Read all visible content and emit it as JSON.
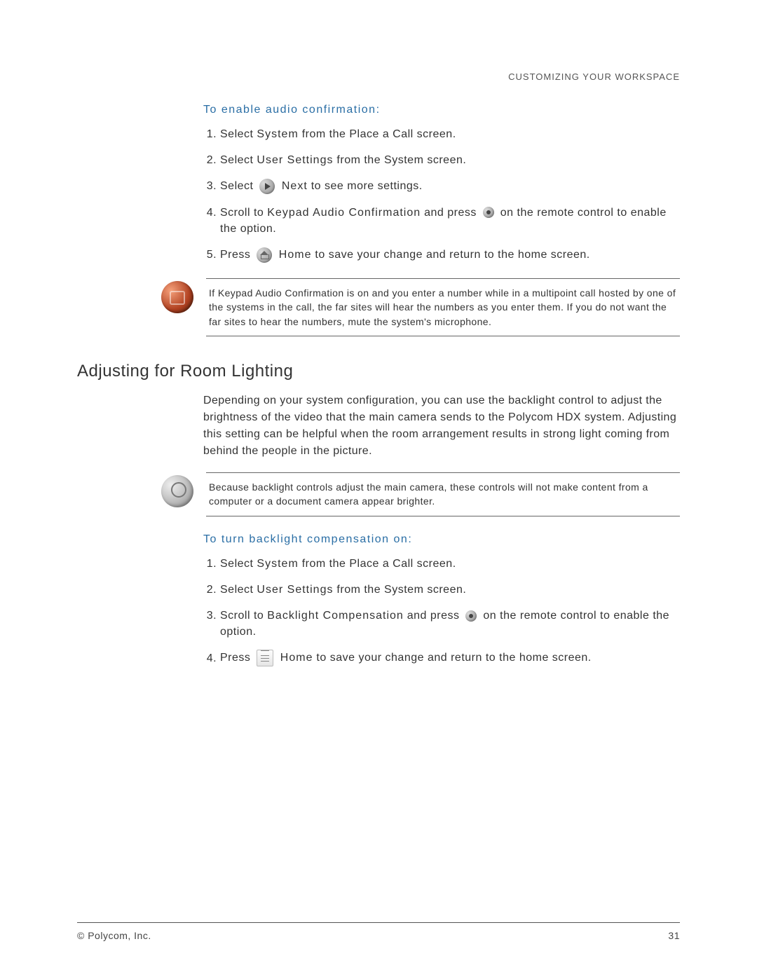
{
  "header": {
    "right": "CUSTOMIZING YOUR WORKSPACE"
  },
  "section1": {
    "proc_title": "To enable audio confirmation:",
    "s1_a": "Select ",
    "s1_b": "System",
    "s1_c": " from the Place a Call screen.",
    "s2_a": "Select ",
    "s2_b": "User Settings",
    "s2_c": " from the System screen.",
    "s3_a": "Select ",
    "s3_b": " Next",
    "s3_c": " to see more settings.",
    "s4_a": "Scroll to ",
    "s4_b": "Keypad Audio Confirmation",
    "s4_c": " and press ",
    "s4_d": " on the remote control to enable the option.",
    "s5_a": "Press ",
    "s5_b": " Home",
    "s5_c": " to save your change and return to the home screen.",
    "note": "If Keypad Audio Confirmation is on and you enter a number while in a multipoint call hosted by one of the systems in the call, the far sites will hear the numbers as you enter them. If you do not want the far sites to hear the numbers, mute the system's microphone."
  },
  "section2": {
    "heading": "Adjusting for Room Lighting",
    "para": "Depending on your system configuration, you can use the backlight control to adjust the brightness of the video that the main camera sends to the Polycom HDX system. Adjusting this setting can be helpful when the room arrangement results in strong light coming from behind the people in the picture.",
    "note": "Because backlight controls adjust the main camera, these controls will not make content from a computer or a document camera appear brighter.",
    "proc_title": "To turn backlight compensation on:",
    "s1_a": "Select ",
    "s1_b": "System",
    "s1_c": " from the Place a Call screen.",
    "s2_a": "Select ",
    "s2_b": "User Settings",
    "s2_c": " from the System screen.",
    "s3_a": "Scroll to ",
    "s3_b": "Backlight Compensation",
    "s3_c": " and press ",
    "s3_d": " on the remote control to enable the option.",
    "s4_a": "Press ",
    "s4_b": " Home",
    "s4_c": " to save your change and return to the home screen."
  },
  "footer": {
    "left": "© Polycom, Inc.",
    "right": "31"
  }
}
